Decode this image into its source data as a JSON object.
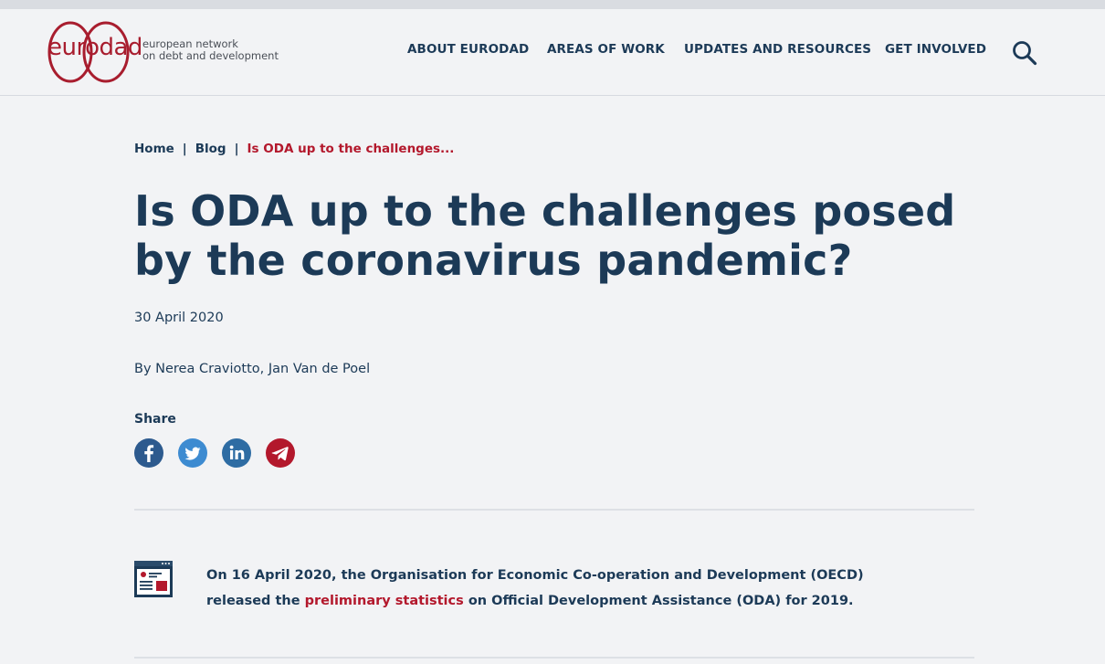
{
  "brand": {
    "logo_word": "eurodad",
    "tagline_line1": "european network",
    "tagline_line2": "on debt and development",
    "colors": {
      "brand_red": "#a81d2e",
      "navy": "#1c3a57",
      "accent_red": "#b3182c"
    }
  },
  "nav": {
    "items": [
      {
        "label": "ABOUT EURODAD"
      },
      {
        "label": "AREAS OF WORK"
      },
      {
        "label": "UPDATES AND RESOURCES"
      },
      {
        "label": "GET INVOLVED"
      }
    ],
    "search_icon": "search-icon"
  },
  "breadcrumb": {
    "home": "Home",
    "blog": "Blog",
    "current": "Is ODA up to the challenges..."
  },
  "article": {
    "title": "Is ODA up to the challenges posed by the coronavirus pandemic?",
    "date": "30 April 2020",
    "byline": "By Nerea Craviotto, Jan Van de Poel",
    "share_label": "Share",
    "share_icons": [
      "facebook-icon",
      "twitter-icon",
      "linkedin-icon",
      "telegram-icon"
    ],
    "intro_before": "On 16 April 2020, the Organisation for Economic Co-operation and Development (OECD) released the ",
    "intro_link": "preliminary statistics",
    "intro_after": " on Official Development Assistance (ODA) for 2019."
  }
}
